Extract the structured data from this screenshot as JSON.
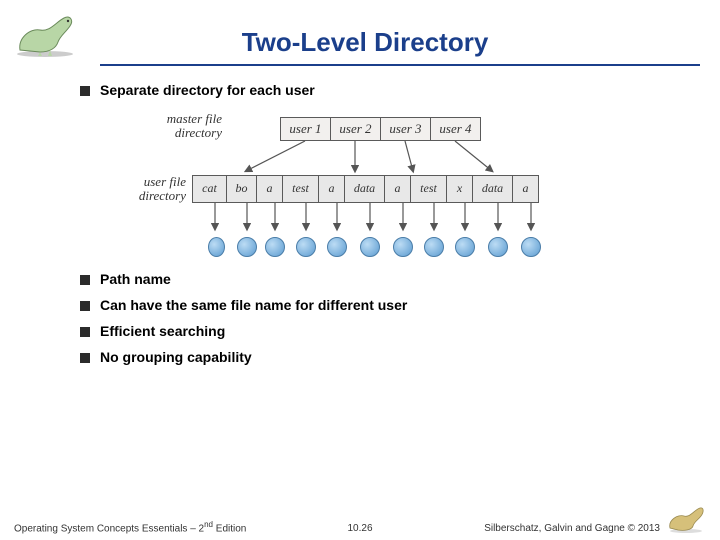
{
  "title": "Two-Level Directory",
  "bullets": {
    "b1": "Separate directory for each user",
    "b2": "Path name",
    "b3": "Can have the same file name for different user",
    "b4": "Efficient searching",
    "b5": "No grouping capability"
  },
  "diagram": {
    "mfd_label_l1": "master file",
    "mfd_label_l2": "directory",
    "mfd": {
      "u1": "user 1",
      "u2": "user 2",
      "u3": "user 3",
      "u4": "user 4"
    },
    "ufd_label_l1": "user file",
    "ufd_label_l2": "directory",
    "ufd_widths": [
      34,
      30,
      26,
      36,
      26,
      40,
      26,
      36,
      26,
      40,
      26
    ],
    "ufd": {
      "f0": "cat",
      "f1": "bo",
      "f2": "a",
      "f3": "test",
      "f4": "a",
      "f5": "data",
      "f6": "a",
      "f7": "test",
      "f8": "x",
      "f9": "data",
      "f10": "a"
    }
  },
  "footer": {
    "left_a": "Operating System Concepts Essentials – 2",
    "left_sup": "nd",
    "left_b": " Edition",
    "center": "10.26",
    "right": "Silberschatz, Galvin and Gagne © 2013"
  }
}
